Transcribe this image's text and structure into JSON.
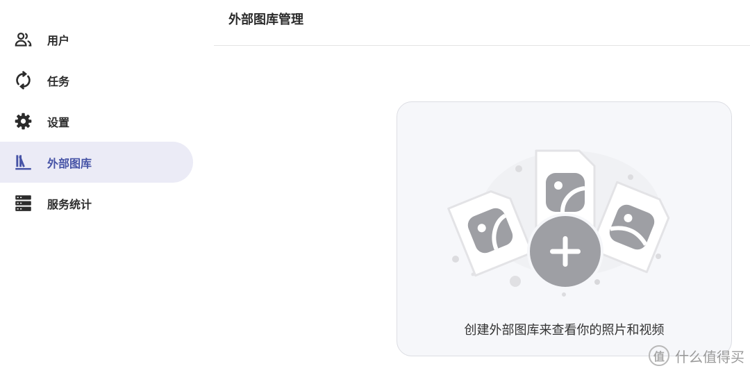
{
  "sidebar": {
    "items": [
      {
        "label": "用户",
        "icon": "users-icon"
      },
      {
        "label": "任务",
        "icon": "sync-icon"
      },
      {
        "label": "设置",
        "icon": "gear-icon"
      },
      {
        "label": "外部图库",
        "icon": "library-icon",
        "active": true
      },
      {
        "label": "服务统计",
        "icon": "server-icon"
      }
    ]
  },
  "header": {
    "title": "外部图库管理"
  },
  "empty_state": {
    "message": "创建外部图库来查看你的照片和视频"
  },
  "watermark": {
    "logo": "值",
    "text": "什么值得买"
  },
  "colors": {
    "accent": "#4653a6",
    "active_bg": "#ebebf6",
    "card_bg": "#f6f7fa",
    "illustration_gray": "#9e9fa4"
  }
}
